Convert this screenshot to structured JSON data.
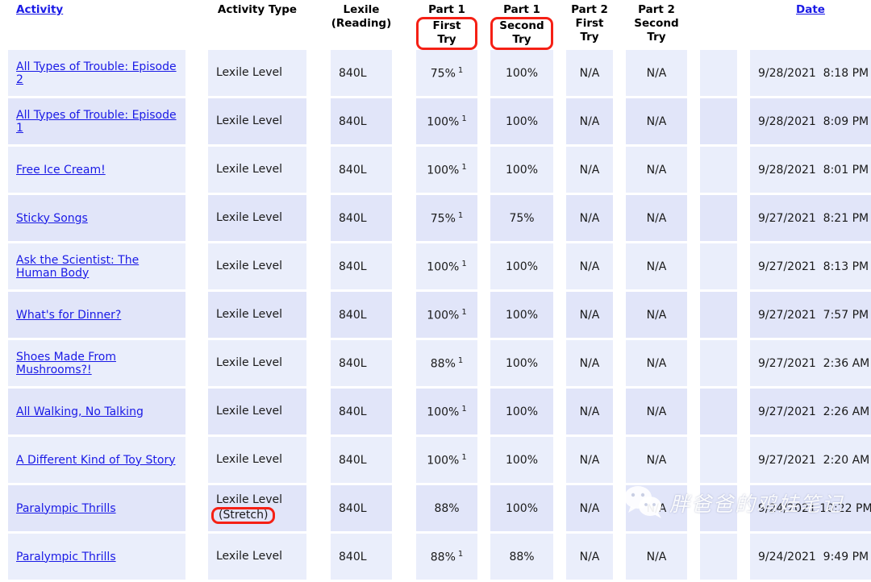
{
  "table": {
    "columns": [
      {
        "key": "activity",
        "label": "Activity",
        "is_link": true,
        "align": "left"
      },
      {
        "key": "type",
        "label": "Activity Type",
        "is_link": false,
        "align": "center"
      },
      {
        "key": "lexile",
        "label_line1": "Lexile",
        "label_line2": "(Reading)",
        "is_link": false,
        "align": "center"
      },
      {
        "key": "p1_first",
        "label_line1": "Part 1",
        "label_line2": "First Try",
        "annotated": true,
        "align": "center"
      },
      {
        "key": "p1_second",
        "label_line1": "Part 1",
        "label_line2": "Second Try",
        "annotated": true,
        "align": "center"
      },
      {
        "key": "p2_first",
        "label_line1": "Part 2",
        "label_line2": "First",
        "label_line3": "Try",
        "annotated": false,
        "align": "center"
      },
      {
        "key": "p2_second",
        "label_line1": "Part 2",
        "label_line2": "Second",
        "label_line3": "Try",
        "annotated": false,
        "align": "center"
      },
      {
        "key": "blank",
        "label": "",
        "is_link": false,
        "align": "center"
      },
      {
        "key": "date",
        "label": "Date",
        "is_link": true,
        "align": "center"
      }
    ],
    "rows": [
      {
        "activity": "All Types of Trouble: Episode 2",
        "type": "Lexile Level",
        "type_note": "",
        "lexile": "840L",
        "p1_first": "75%",
        "p1_first_sup": "1",
        "p1_second": "100%",
        "p2_first": "N/A",
        "p2_second": "N/A",
        "date": "9/28/2021  8:18 PM"
      },
      {
        "activity": "All Types of Trouble: Episode 1",
        "type": "Lexile Level",
        "type_note": "",
        "lexile": "840L",
        "p1_first": "100%",
        "p1_first_sup": "1",
        "p1_second": "100%",
        "p2_first": "N/A",
        "p2_second": "N/A",
        "date": "9/28/2021  8:09 PM"
      },
      {
        "activity": "Free Ice Cream!",
        "type": "Lexile Level",
        "type_note": "",
        "lexile": "840L",
        "p1_first": "100%",
        "p1_first_sup": "1",
        "p1_second": "100%",
        "p2_first": "N/A",
        "p2_second": "N/A",
        "date": "9/28/2021  8:01 PM"
      },
      {
        "activity": "Sticky Songs",
        "type": "Lexile Level",
        "type_note": "",
        "lexile": "840L",
        "p1_first": "75%",
        "p1_first_sup": "1",
        "p1_second": "75%",
        "p2_first": "N/A",
        "p2_second": "N/A",
        "date": "9/27/2021  8:21 PM"
      },
      {
        "activity": "Ask the Scientist: The Human Body",
        "type": "Lexile Level",
        "type_note": "",
        "lexile": "840L",
        "p1_first": "100%",
        "p1_first_sup": "1",
        "p1_second": "100%",
        "p2_first": "N/A",
        "p2_second": "N/A",
        "date": "9/27/2021  8:13 PM"
      },
      {
        "activity": "What's for Dinner?",
        "type": "Lexile Level",
        "type_note": "",
        "lexile": "840L",
        "p1_first": "100%",
        "p1_first_sup": "1",
        "p1_second": "100%",
        "p2_first": "N/A",
        "p2_second": "N/A",
        "date": "9/27/2021  7:57 PM"
      },
      {
        "activity": "Shoes Made From Mushrooms?!",
        "type": "Lexile Level",
        "type_note": "",
        "lexile": "840L",
        "p1_first": "88%",
        "p1_first_sup": "1",
        "p1_second": "100%",
        "p2_first": "N/A",
        "p2_second": "N/A",
        "date": "9/27/2021  2:36 AM"
      },
      {
        "activity": "All Walking, No Talking",
        "type": "Lexile Level",
        "type_note": "",
        "lexile": "840L",
        "p1_first": "100%",
        "p1_first_sup": "1",
        "p1_second": "100%",
        "p2_first": "N/A",
        "p2_second": "N/A",
        "date": "9/27/2021  2:26 AM"
      },
      {
        "activity": "A Different Kind of Toy Story",
        "type": "Lexile Level",
        "type_note": "",
        "lexile": "840L",
        "p1_first": "100%",
        "p1_first_sup": "1",
        "p1_second": "100%",
        "p2_first": "N/A",
        "p2_second": "N/A",
        "date": "9/27/2021  2:20 AM"
      },
      {
        "activity": "Paralympic Thrills",
        "type": "Lexile Level",
        "type_note": "(Stretch)",
        "type_note_annotated": true,
        "lexile": "840L",
        "p1_first": "88%",
        "p1_first_sup": "",
        "p1_second": "100%",
        "p2_first": "N/A",
        "p2_second": "N/A",
        "date": "9/24/2021 10:22 PM"
      },
      {
        "activity": "Paralympic Thrills",
        "type": "Lexile Level",
        "type_note": "",
        "lexile": "840L",
        "p1_first": "88%",
        "p1_first_sup": "1",
        "p1_second": "88%",
        "p2_first": "N/A",
        "p2_second": "N/A",
        "date": "9/24/2021  9:49 PM"
      }
    ]
  },
  "watermark": {
    "icon": "wechat-icon",
    "text": "胖爸爸的鸡娃笔记"
  },
  "colors": {
    "link": "#1a1ae6",
    "annotation": "#f52015",
    "row_odd": "#eaeefb",
    "row_even": "#e1e5f9",
    "page_bg": "#ffffff"
  }
}
